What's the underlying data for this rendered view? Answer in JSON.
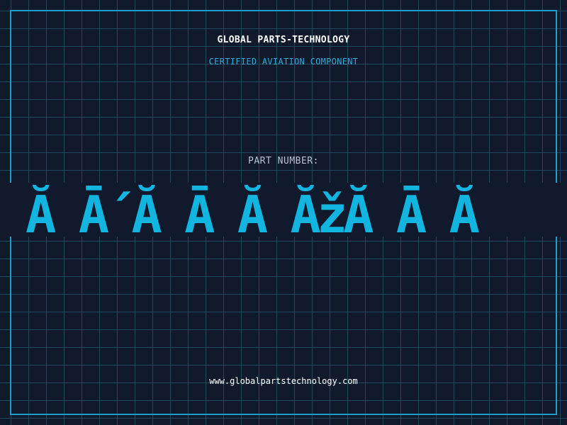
{
  "header": {
    "title": "GLOBAL PARTS-TECHNOLOGY",
    "subtitle": "CERTIFIED AVIATION COMPONENT"
  },
  "part": {
    "label": "PART NUMBER:",
    "value": "Ă Ā´Ă Ā Ă ĂžĂ Ā Ă"
  },
  "footer": {
    "website": "www.globalpartstechnology.com"
  },
  "colors": {
    "background": "#111a2c",
    "grid": "#1f4a5e",
    "frame": "#1a9ec8",
    "accent": "#12b4e0",
    "subtitle": "#2eaad8",
    "title": "#ffffff"
  }
}
